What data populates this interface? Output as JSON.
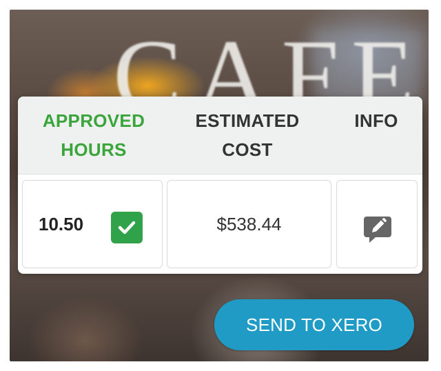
{
  "background": {
    "sign_text": "CAFE"
  },
  "table": {
    "headers": [
      {
        "line1": "APPROVED",
        "line2": "HOURS"
      },
      {
        "line1": "ESTIMATED",
        "line2": "COST"
      },
      {
        "line1": "INFO",
        "line2": ""
      }
    ],
    "row": {
      "hours": "10.50",
      "approved": true,
      "estimated_cost": "$538.44",
      "info_icon": "edit-note-icon"
    }
  },
  "actions": {
    "send_label": "SEND TO XERO"
  },
  "colors": {
    "approved_green": "#3aa53b",
    "check_green": "#2fa24a",
    "button_blue": "#1f9bc6",
    "icon_gray": "#666666"
  }
}
